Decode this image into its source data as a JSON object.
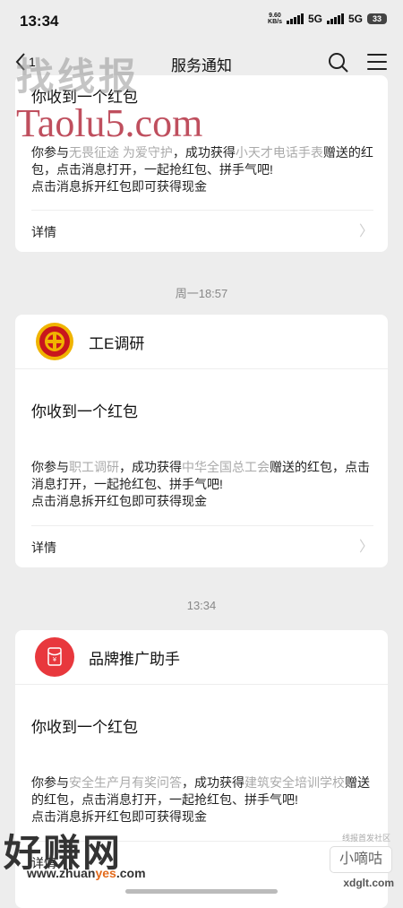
{
  "status_bar": {
    "time": "13:34",
    "net_speed_value": "9.60",
    "net_speed_unit": "KB/s",
    "signal1": "5G",
    "signal2": "5G",
    "battery": "33"
  },
  "nav": {
    "back_count": "1",
    "title": "服务通知"
  },
  "cards": [
    {
      "subject": "你收到一个红包",
      "body_prefix": "你参与",
      "activity": "无畏征途 为爱守护",
      "body_mid": "，成功获得",
      "sponsor": "小天才电话手表",
      "body_suffix": "赠送的红包，点击消息打开，一起抢红包、拼手气吧!",
      "body_line2": "点击消息拆开红包即可获得现金",
      "detail": "详情"
    },
    {
      "sender": "工E调研",
      "subject": "你收到一个红包",
      "body_prefix": "你参与",
      "activity": "职工调研",
      "body_mid": "，成功获得",
      "sponsor": "中华全国总工会",
      "body_suffix": "赠送的红包，点击消息打开，一起抢红包、拼手气吧!",
      "body_line2": "点击消息拆开红包即可获得现金",
      "detail": "详情"
    },
    {
      "sender": "品牌推广助手",
      "subject": "你收到一个红包",
      "body_prefix": "你参与",
      "activity": "安全生产月有奖问答",
      "body_mid": "，成功获得",
      "sponsor": "建筑安全培训学校",
      "body_suffix": "赠送的红包，点击消息打开，一起抢红包、拼手气吧!",
      "body_line2": "点击消息拆开红包即可获得现金",
      "detail": "详情"
    }
  ],
  "timestamps": [
    "周一18:57",
    "13:34"
  ],
  "watermarks": {
    "top": "找线报",
    "taolu": "Taolu5.com",
    "bottom": "好赚网",
    "bottom_url_a": "www.zhuan",
    "bottom_url_b": "yes",
    "bottom_url_c": ".com",
    "br_small": "线报首发社区",
    "br_box": "小嘀咕",
    "br_url": "xdglt.com"
  },
  "colors": {
    "background": "#ededed",
    "highlight_text": "#aaaaaa",
    "red_packet": "#e8383d",
    "union_red": "#c8161d",
    "union_gold": "#f0b400"
  },
  "icons": [
    "back-chevron-icon",
    "search-icon",
    "menu-icon",
    "union-logo-icon",
    "red-packet-icon",
    "chevron-right-icon"
  ]
}
